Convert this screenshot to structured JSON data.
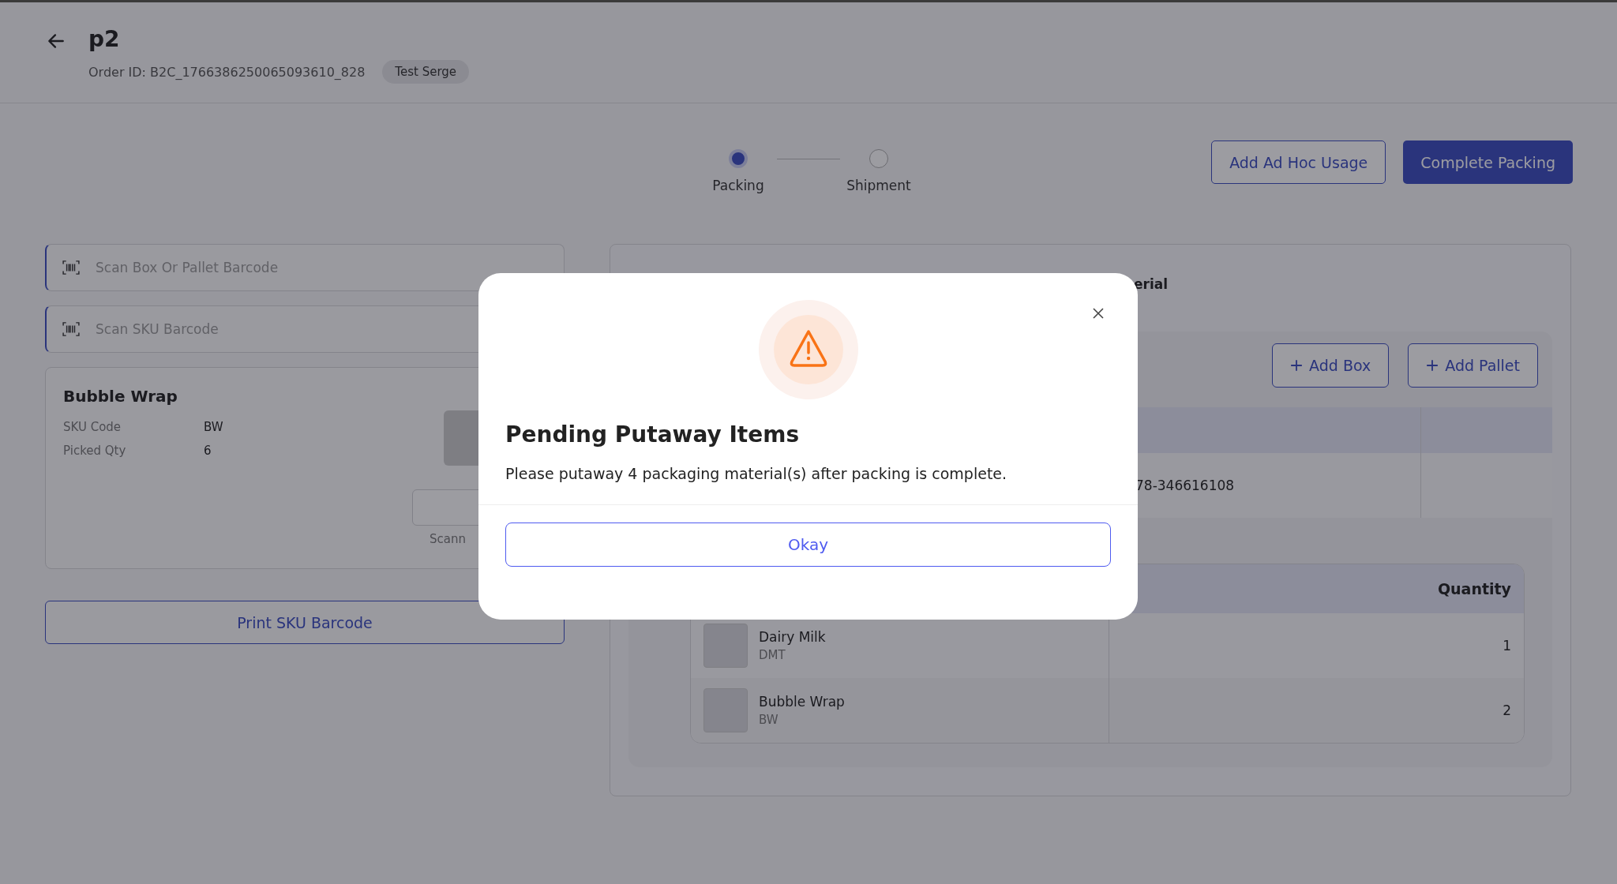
{
  "header": {
    "title": "p2",
    "order_id": "Order ID: B2C_1766386250065093610_828",
    "badge": "Test Serge"
  },
  "stepper": [
    {
      "label": "Packing",
      "selected": true
    },
    {
      "label": "Shipment",
      "selected": false
    }
  ],
  "actions": [
    {
      "label": "Add Ad Hoc Usage",
      "kind": "outline"
    },
    {
      "label": "Complete Packing",
      "kind": "primary"
    }
  ],
  "scan_fields": [
    {
      "placeholder": "Scan Box Or Pallet Barcode"
    },
    {
      "placeholder": "Scan SKU Barcode"
    }
  ],
  "item_card": {
    "name": "Bubble Wrap",
    "fields": [
      {
        "label": "SKU Code",
        "value": "BW"
      },
      {
        "label": "Picked Qty",
        "value": "6"
      }
    ],
    "caption": "Scann"
  },
  "print_button": "Print SKU Barcode",
  "packing_panel": {
    "heading": "erial",
    "buttons": [
      "Add Box",
      "Add Pallet"
    ],
    "box_cell": "78-346616108",
    "items_table": {
      "columns": [
        "Quantity"
      ],
      "rows": [
        {
          "name": "Dairy Milk",
          "sku": "DMT",
          "quantity": "1"
        },
        {
          "name": "Bubble Wrap",
          "sku": "BW",
          "quantity": "2"
        }
      ]
    }
  },
  "dialog": {
    "title": "Pending Putaway Items",
    "message": "Please putaway 4 packaging material(s) after packing is complete.",
    "button": "Okay"
  }
}
